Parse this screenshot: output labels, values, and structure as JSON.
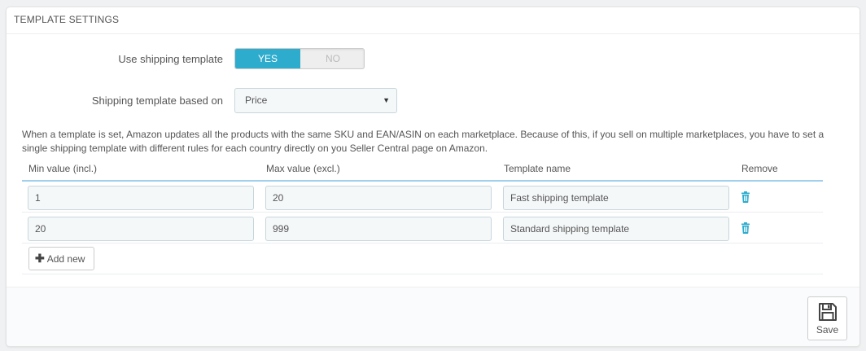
{
  "panel": {
    "title": "TEMPLATE SETTINGS"
  },
  "form": {
    "use_template": {
      "label": "Use shipping template",
      "yes": "YES",
      "no": "NO",
      "selected": "YES"
    },
    "based_on": {
      "label": "Shipping template based on",
      "value": "Price"
    }
  },
  "notice": "When a template is set, Amazon updates all the products with the same SKU and EAN/ASIN on each marketplace. Because of this, if you sell on multiple marketplaces, you have to set a single shipping template with different rules for each country directly on you Seller Central page on Amazon.",
  "table": {
    "headers": {
      "min": "Min value (incl.)",
      "max": "Max value (excl.)",
      "name": "Template name",
      "remove": "Remove"
    },
    "rows": [
      {
        "min": "1",
        "max": "20",
        "name": "Fast shipping template"
      },
      {
        "min": "20",
        "max": "999",
        "name": "Standard shipping template"
      }
    ],
    "add_label": "Add new"
  },
  "footer": {
    "save_label": "Save"
  },
  "colors": {
    "accent": "#2eacce",
    "header_rule": "#a0d0eb"
  },
  "icons": {
    "remove": "trash-icon",
    "add": "plus-icon",
    "save": "floppy-disk-icon",
    "select": "caret-down-icon"
  }
}
